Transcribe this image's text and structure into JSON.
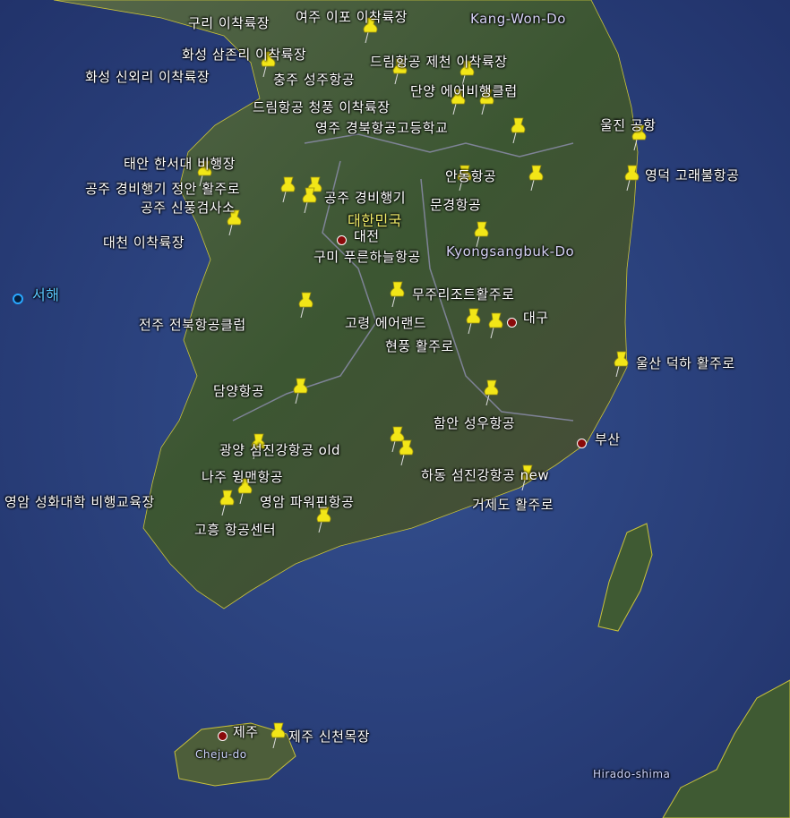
{
  "colors": {
    "sea": "#2a3f7a",
    "land": "#3f5a33",
    "pin": "#f2e617",
    "label": "#ffffff",
    "country": "#f4ef6a",
    "region": "#d6d2f5",
    "sea_label": "#5ac8ff"
  },
  "labels": [
    {
      "text": "구리 이착륙장",
      "kind": "place"
    },
    {
      "text": "여주 이포 이착륙장",
      "kind": "place"
    },
    {
      "text": "Kang-Won-Do",
      "kind": "region"
    },
    {
      "text": "화성 삼존리 이착륙장",
      "kind": "place"
    },
    {
      "text": "드림항공 제천 이착륙장",
      "kind": "place"
    },
    {
      "text": "화성 신외리 이착륙장",
      "kind": "place"
    },
    {
      "text": "충주 성주항공",
      "kind": "place"
    },
    {
      "text": "단양 에어비행클럽",
      "kind": "place"
    },
    {
      "text": "드림항공 청풍 이착륙장",
      "kind": "place"
    },
    {
      "text": "울진 공항",
      "kind": "place"
    },
    {
      "text": "영주 경북항공고등학교",
      "kind": "place"
    },
    {
      "text": "태안 한서대 비행장",
      "kind": "place"
    },
    {
      "text": "안동항공",
      "kind": "place"
    },
    {
      "text": "영덕 고래불항공",
      "kind": "place"
    },
    {
      "text": "공주 경비행기 정안 활주로",
      "kind": "place"
    },
    {
      "text": "공주 경비행기",
      "kind": "place"
    },
    {
      "text": "문경항공",
      "kind": "place"
    },
    {
      "text": "공주 신풍검사소",
      "kind": "place"
    },
    {
      "text": "대한민국",
      "kind": "country"
    },
    {
      "text": "대전",
      "kind": "city"
    },
    {
      "text": "대천 이착륙장",
      "kind": "place"
    },
    {
      "text": "구미 푸른하늘항공",
      "kind": "place"
    },
    {
      "text": "Kyongsangbuk-Do",
      "kind": "region"
    },
    {
      "text": "서해",
      "kind": "sea"
    },
    {
      "text": "무주리조트활주로",
      "kind": "place"
    },
    {
      "text": "대구",
      "kind": "city"
    },
    {
      "text": "전주 전북항공클럽",
      "kind": "place"
    },
    {
      "text": "고령 에어랜드",
      "kind": "place"
    },
    {
      "text": "현풍 활주로",
      "kind": "place"
    },
    {
      "text": "울산 덕하 활주로",
      "kind": "place"
    },
    {
      "text": "담양항공",
      "kind": "place"
    },
    {
      "text": "함안 성우항공",
      "kind": "place"
    },
    {
      "text": "부산",
      "kind": "city"
    },
    {
      "text": "광양 섬진강항공 old",
      "kind": "place"
    },
    {
      "text": "나주 윙맨항공",
      "kind": "place"
    },
    {
      "text": "하동 섬진강항공 new",
      "kind": "place"
    },
    {
      "text": "영암 성화대학 비행교육장",
      "kind": "place"
    },
    {
      "text": "영암 파워핀항공",
      "kind": "place"
    },
    {
      "text": "거제도 활주로",
      "kind": "place"
    },
    {
      "text": "고흥 항공센터",
      "kind": "place"
    },
    {
      "text": "제주",
      "kind": "city"
    },
    {
      "text": "제주 신천목장",
      "kind": "place"
    },
    {
      "text": "Cheju-do",
      "kind": "small"
    },
    {
      "text": "Hirado-shima",
      "kind": "small"
    }
  ],
  "pin_icon": "yellow-pushpin-icon",
  "city_icon": "red-dot-icon"
}
